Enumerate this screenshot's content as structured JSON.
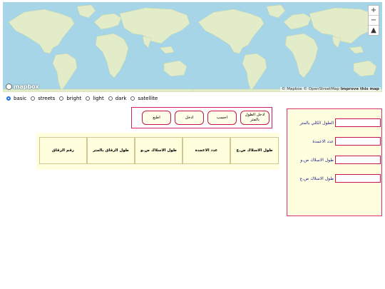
{
  "map": {
    "logo": "mapbox",
    "attribution": {
      "mapbox": "© Mapbox",
      "osm": "© OpenStreetMap",
      "improve": "Improve this map"
    },
    "zoom_in": "+",
    "zoom_out": "−",
    "compass": "▲"
  },
  "styles": {
    "options": [
      "basic",
      "streets",
      "bright",
      "light",
      "dark",
      "satellite"
    ],
    "selected": "basic"
  },
  "buttons": {
    "enter_length": "ادخل الطول بالمتر",
    "calculate": "احسب",
    "enter": "ادخل",
    "print": "اطبع"
  },
  "table": {
    "headers": [
      "طول الاسلاك ض.ع",
      "عدد الاعمدة",
      "طول الاسلاك ض.و",
      "طول الزقاق بالمتر",
      "رقم الزقاق"
    ]
  },
  "panel": {
    "labels": [
      "الطول الكلي بالمتر",
      "عدد الاعمدة",
      "طول الاسلاك ض.و",
      "طول الاسلاك ض.ع"
    ],
    "values": [
      "",
      "",
      "",
      ""
    ]
  },
  "colors": {
    "ocean": "#a6d5e7",
    "land": "#e8efd0",
    "accent": "#d0206a",
    "panel_bg": "#ffffe0"
  }
}
